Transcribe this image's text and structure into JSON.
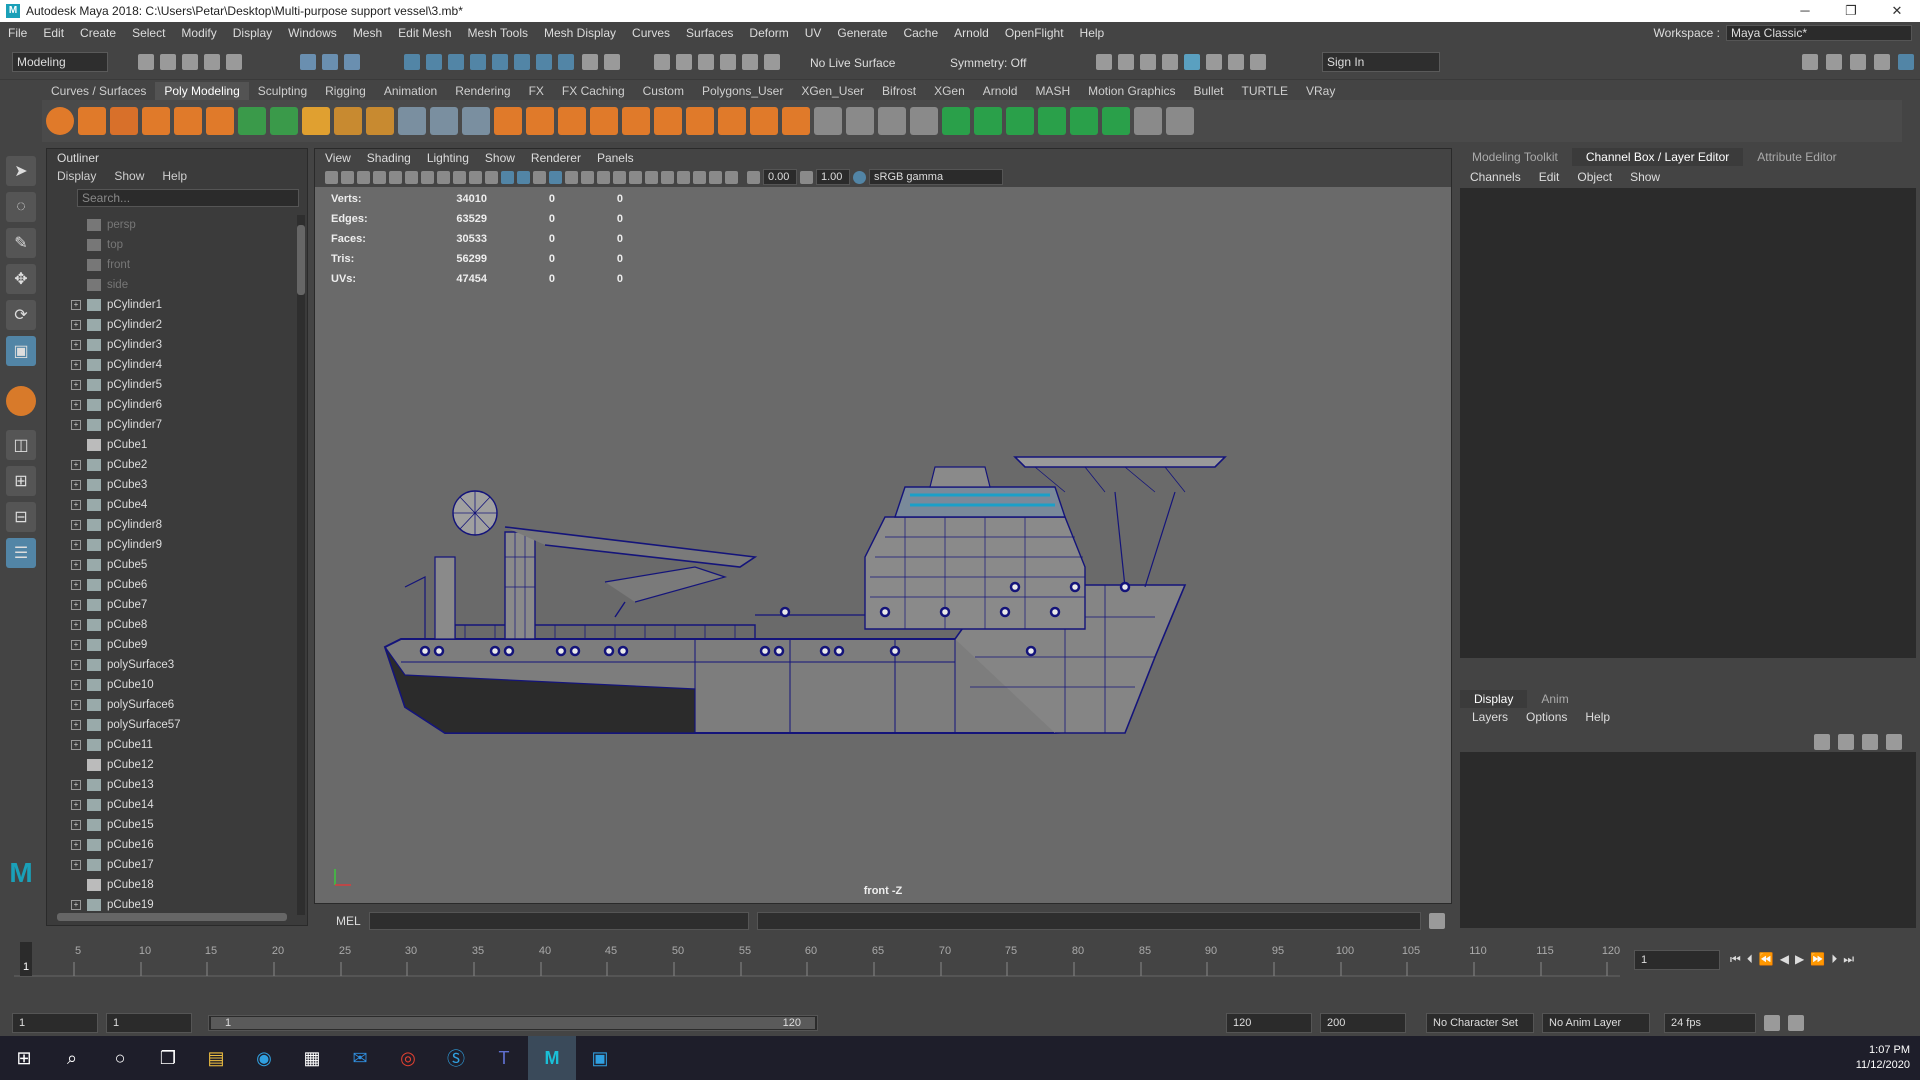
{
  "window": {
    "title": "Autodesk Maya 2018: C:\\Users\\Petar\\Desktop\\Multi-purpose support vessel\\3.mb*"
  },
  "menus": [
    "File",
    "Edit",
    "Create",
    "Select",
    "Modify",
    "Display",
    "Windows",
    "Mesh",
    "Edit Mesh",
    "Mesh Tools",
    "Mesh Display",
    "Curves",
    "Surfaces",
    "Deform",
    "UV",
    "Generate",
    "Cache",
    "Arnold",
    "OpenFlight",
    "Help"
  ],
  "workspace": {
    "label": "Workspace :",
    "value": "Maya Classic*"
  },
  "status": {
    "mode": "Modeling",
    "live_surface": "No Live Surface",
    "symmetry": "Symmetry: Off",
    "sign_in": "Sign In"
  },
  "shelf_tabs": [
    "Curves / Surfaces",
    "Poly Modeling",
    "Sculpting",
    "Rigging",
    "Animation",
    "Rendering",
    "FX",
    "FX Caching",
    "Custom",
    "Polygons_User",
    "XGen_User",
    "Bifrost",
    "XGen",
    "Arnold",
    "MASH",
    "Motion Graphics",
    "Bullet",
    "TURTLE",
    "VRay"
  ],
  "outliner": {
    "title": "Outliner",
    "menu": [
      "Display",
      "Show",
      "Help"
    ],
    "search_placeholder": "Search...",
    "cameras": [
      "persp",
      "top",
      "front",
      "side"
    ],
    "items": [
      "pCylinder1",
      "pCylinder2",
      "pCylinder3",
      "pCylinder4",
      "pCylinder5",
      "pCylinder6",
      "pCylinder7",
      "pCube1",
      "pCube2",
      "pCube3",
      "pCube4",
      "pCylinder8",
      "pCylinder9",
      "pCube5",
      "pCube6",
      "pCube7",
      "pCube8",
      "pCube9",
      "polySurface3",
      "pCube10",
      "polySurface6",
      "polySurface57",
      "pCube11",
      "pCube12",
      "pCube13",
      "pCube14",
      "pCube15",
      "pCube16",
      "pCube17",
      "pCube18",
      "pCube19"
    ]
  },
  "viewport": {
    "menu": [
      "View",
      "Shading",
      "Lighting",
      "Show",
      "Renderer",
      "Panels"
    ],
    "exposure": "0.00",
    "gamma": "1.00",
    "colorspace": "sRGB gamma",
    "camera_label": "front -Z",
    "hud": {
      "rows": [
        {
          "label": "Verts:",
          "value": "34010",
          "sel": "0",
          "comp": "0"
        },
        {
          "label": "Edges:",
          "value": "63529",
          "sel": "0",
          "comp": "0"
        },
        {
          "label": "Faces:",
          "value": "30533",
          "sel": "0",
          "comp": "0"
        },
        {
          "label": "Tris:",
          "value": "56299",
          "sel": "0",
          "comp": "0"
        },
        {
          "label": "UVs:",
          "value": "47454",
          "sel": "0",
          "comp": "0"
        }
      ]
    }
  },
  "command_line": {
    "label": "MEL"
  },
  "right_panel": {
    "tabs": [
      "Modeling Toolkit",
      "Channel Box / Layer Editor",
      "Attribute Editor"
    ],
    "channel_menu": [
      "Channels",
      "Edit",
      "Object",
      "Show"
    ],
    "layer_tabs": [
      "Display",
      "Anim"
    ],
    "layer_menu": [
      "Layers",
      "Options",
      "Help"
    ]
  },
  "timeline": {
    "ticks": [
      "5",
      "10",
      "15",
      "20",
      "25",
      "30",
      "35",
      "40",
      "45",
      "50",
      "55",
      "60",
      "65",
      "70",
      "75",
      "80",
      "85",
      "90",
      "95",
      "100",
      "105",
      "110",
      "115",
      "120"
    ],
    "current_frame_label": "1",
    "current_field": "1"
  },
  "range": {
    "start": "1",
    "playback_start": "1",
    "slider_start": "1",
    "slider_end": "120",
    "playback_end": "120",
    "end": "200",
    "character_set": "No Character Set",
    "anim_layer": "No Anim Layer",
    "fps": "24 fps"
  },
  "taskbar": {
    "time": "1:07 PM",
    "date": "11/12/2020"
  },
  "colors": {
    "wireframe": "#14147a",
    "viewport_bg": "#6a6a6a",
    "panel_bg": "#444444",
    "accent": "#5285a6"
  }
}
